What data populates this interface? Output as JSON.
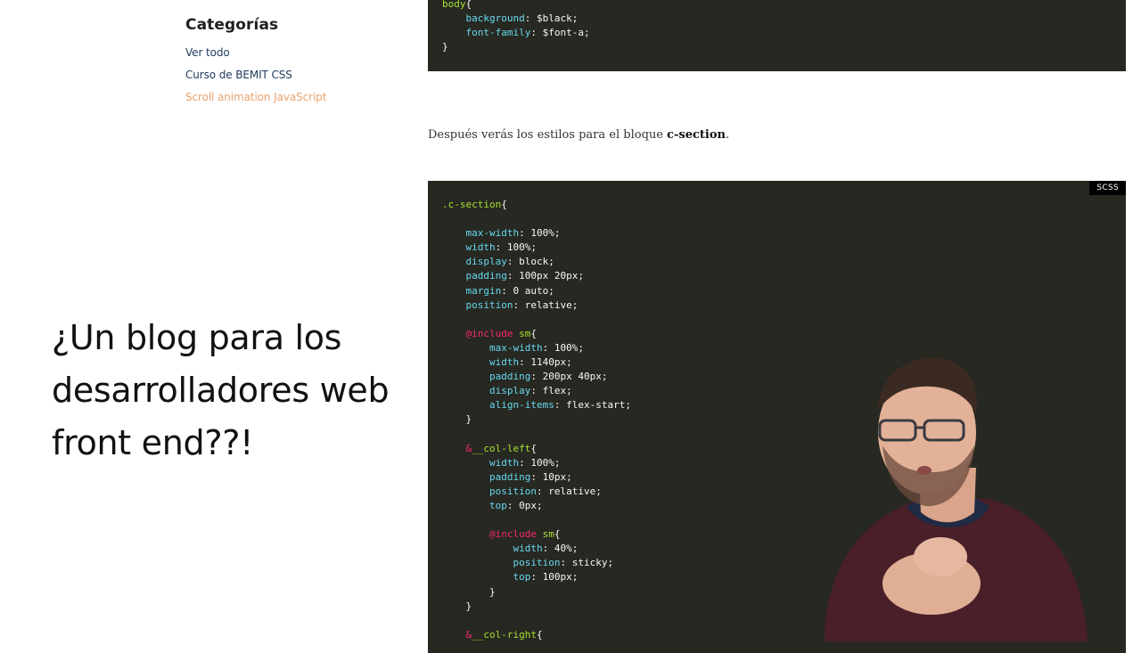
{
  "sidebar": {
    "title": "Categorías",
    "items": [
      {
        "label": "Ver todo",
        "active": false
      },
      {
        "label": "Curso de BEMIT CSS",
        "active": false
      },
      {
        "label": "Scroll animation JavaScript",
        "active": true
      }
    ]
  },
  "overlay": {
    "headline": "¿Un blog para los desarrolladores web front end??!"
  },
  "article": {
    "paragraph_before": "Después verás los estilos para el bloque ",
    "paragraph_strong": "c-section",
    "paragraph_after": "."
  },
  "code_top": {
    "lines": [
      [
        [
          "sel",
          "body"
        ],
        [
          "val",
          "{"
        ]
      ],
      [
        [
          "val",
          "    "
        ],
        [
          "prop",
          "background"
        ],
        [
          "val",
          ": $black;"
        ]
      ],
      [
        [
          "val",
          "    "
        ],
        [
          "prop",
          "font-family"
        ],
        [
          "val",
          ": $font-a;"
        ]
      ],
      [
        [
          "val",
          "}"
        ]
      ]
    ]
  },
  "code_main": {
    "language": "SCSS",
    "lines": [
      [
        [
          "sel",
          ".c-section"
        ],
        [
          "val",
          "{"
        ]
      ],
      [],
      [
        [
          "val",
          "    "
        ],
        [
          "prop",
          "max-width"
        ],
        [
          "val",
          ": 100%;"
        ]
      ],
      [
        [
          "val",
          "    "
        ],
        [
          "prop",
          "width"
        ],
        [
          "val",
          ": 100%;"
        ]
      ],
      [
        [
          "val",
          "    "
        ],
        [
          "prop",
          "display"
        ],
        [
          "val",
          ": block;"
        ]
      ],
      [
        [
          "val",
          "    "
        ],
        [
          "prop",
          "padding"
        ],
        [
          "val",
          ": 100px 20px;"
        ]
      ],
      [
        [
          "val",
          "    "
        ],
        [
          "prop",
          "margin"
        ],
        [
          "val",
          ": 0 auto;"
        ]
      ],
      [
        [
          "val",
          "    "
        ],
        [
          "prop",
          "position"
        ],
        [
          "val",
          ": relative;"
        ]
      ],
      [],
      [
        [
          "val",
          "    "
        ],
        [
          "at",
          "@include"
        ],
        [
          "val",
          " "
        ],
        [
          "sel",
          "sm"
        ],
        [
          "val",
          "{"
        ]
      ],
      [
        [
          "val",
          "        "
        ],
        [
          "prop",
          "max-width"
        ],
        [
          "val",
          ": 100%;"
        ]
      ],
      [
        [
          "val",
          "        "
        ],
        [
          "prop",
          "width"
        ],
        [
          "val",
          ": 1140px;"
        ]
      ],
      [
        [
          "val",
          "        "
        ],
        [
          "prop",
          "padding"
        ],
        [
          "val",
          ": 200px 40px;"
        ]
      ],
      [
        [
          "val",
          "        "
        ],
        [
          "prop",
          "display"
        ],
        [
          "val",
          ": flex;"
        ]
      ],
      [
        [
          "val",
          "        "
        ],
        [
          "prop",
          "align-items"
        ],
        [
          "val",
          ": flex-start;"
        ]
      ],
      [
        [
          "val",
          "    }"
        ]
      ],
      [],
      [
        [
          "val",
          "    "
        ],
        [
          "at",
          "&"
        ],
        [
          "sel",
          "__col-left"
        ],
        [
          "val",
          "{"
        ]
      ],
      [
        [
          "val",
          "        "
        ],
        [
          "prop",
          "width"
        ],
        [
          "val",
          ": 100%;"
        ]
      ],
      [
        [
          "val",
          "        "
        ],
        [
          "prop",
          "padding"
        ],
        [
          "val",
          ": 10px;"
        ]
      ],
      [
        [
          "val",
          "        "
        ],
        [
          "prop",
          "position"
        ],
        [
          "val",
          ": relative;"
        ]
      ],
      [
        [
          "val",
          "        "
        ],
        [
          "prop",
          "top"
        ],
        [
          "val",
          ": 0px;"
        ]
      ],
      [],
      [
        [
          "val",
          "        "
        ],
        [
          "at",
          "@include"
        ],
        [
          "val",
          " "
        ],
        [
          "sel",
          "sm"
        ],
        [
          "val",
          "{"
        ]
      ],
      [
        [
          "val",
          "            "
        ],
        [
          "prop",
          "width"
        ],
        [
          "val",
          ": 40%;"
        ]
      ],
      [
        [
          "val",
          "            "
        ],
        [
          "prop",
          "position"
        ],
        [
          "val",
          ": sticky;"
        ]
      ],
      [
        [
          "val",
          "            "
        ],
        [
          "prop",
          "top"
        ],
        [
          "val",
          ": 100px;"
        ]
      ],
      [
        [
          "val",
          "        }"
        ]
      ],
      [
        [
          "val",
          "    }"
        ]
      ],
      [],
      [
        [
          "val",
          "    "
        ],
        [
          "at",
          "&"
        ],
        [
          "sel",
          "__col-right"
        ],
        [
          "val",
          "{"
        ]
      ]
    ]
  },
  "colors": {
    "code_background": "#272822",
    "selector": "#a6e22e",
    "property": "#66d9ef",
    "at_rule": "#f92672",
    "text": "#f8f8f2",
    "link": "#1f3a5c",
    "link_active": "#e8a36e"
  }
}
